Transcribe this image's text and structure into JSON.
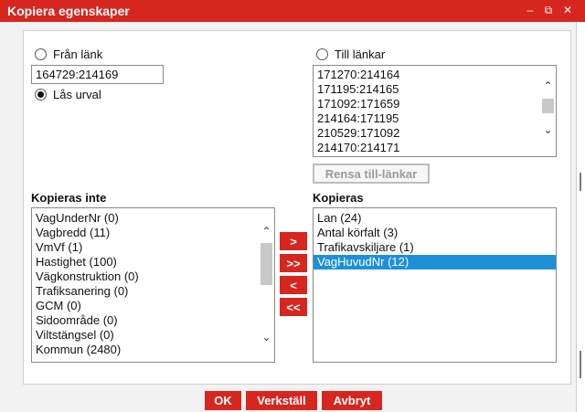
{
  "window": {
    "title": "Kopiera egenskaper",
    "controls": {
      "minimize": "–",
      "popout": "⧉",
      "close": "✕"
    }
  },
  "from_link": {
    "radio_label": "Från länk",
    "value": "164729:214169",
    "lock_label": "Lås urval",
    "lock_checked": true
  },
  "to_links": {
    "radio_label": "Till länkar",
    "items": [
      "171270:214164",
      "171195:214165",
      "171092:171659",
      "214164:171195",
      "210529:171092",
      "214170:214171"
    ],
    "clear_label": "Rensa till-länkar"
  },
  "not_copied": {
    "heading": "Kopieras inte",
    "items": [
      "VagUnderNr (0)",
      "Vagbredd (11)",
      "VmVf (1)",
      "Hastighet (100)",
      "Vägkonstruktion (0)",
      "Trafiksanering (0)",
      "GCM (0)",
      "Sidoområde (0)",
      "Viltstängsel (0)",
      "Kommun (2480)"
    ]
  },
  "copied": {
    "heading": "Kopieras",
    "items": [
      "Lan (24)",
      "Antal körfalt (3)",
      "Trafikavskiljare (1)",
      "VagHuvudNr (12)"
    ],
    "selected_index": 3
  },
  "transfer": {
    "move_right": ">",
    "move_all_right": ">>",
    "move_left": "<",
    "move_all_left": "<<"
  },
  "footer": {
    "ok": "OK",
    "apply": "Verkställ",
    "cancel": "Avbryt"
  },
  "scroll_icons": {
    "up": "⌃",
    "down": "⌄"
  },
  "colors": {
    "accent": "#d7261f",
    "selection": "#1e90d8"
  }
}
